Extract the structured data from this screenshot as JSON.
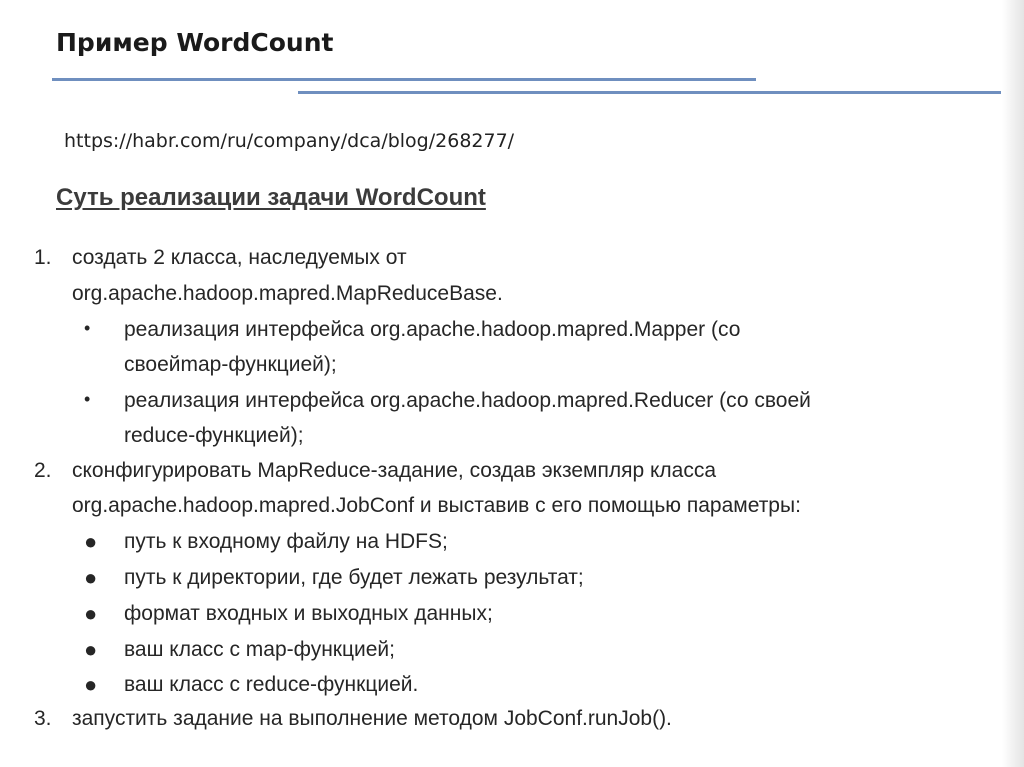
{
  "slide": {
    "title": "Пример WordCount",
    "url": "https://habr.com/ru/company/dca/blog/268277/",
    "subtitle": "Суть реализации задачи WordCount",
    "accent_color": "#6f8fbf",
    "list": [
      {
        "number": "1.",
        "lines": [
          "создать 2 класса, наследуемых от",
          "org.apache.hadoop.mapred.MapReduceBase."
        ],
        "bullet_icon": "bullet-icon",
        "subitems": [
          {
            "bullet": "•",
            "lines": [
              "реализация интерфейса org.apache.hadoop.mapred.Mapper (со",
              "своейmap-функцией);"
            ]
          },
          {
            "bullet": "•",
            "lines": [
              "реализация интерфейса org.apache.hadoop.mapred.Reducer (со своей",
              "reduce-функцией);"
            ]
          }
        ]
      },
      {
        "number": "2.",
        "lines": [
          "сконфигурировать MapReduce-задание, создав экземпляр класса",
          "org.apache.hadoop.mapred.JobConf и выставив с его помощью параметры:"
        ],
        "bullet_icon": "dot-icon",
        "subitems": [
          {
            "bullet": "●",
            "lines": [
              "путь к входному файлу на HDFS;"
            ]
          },
          {
            "bullet": "●",
            "lines": [
              "путь к директории, где будет лежать результат;"
            ]
          },
          {
            "bullet": "●",
            "lines": [
              "формат входных и выходных данных;"
            ]
          },
          {
            "bullet": "●",
            "lines": [
              "ваш класс с map-функцией;"
            ]
          },
          {
            "bullet": "●",
            "lines": [
              "ваш класс с reduce-функцией."
            ]
          }
        ]
      },
      {
        "number": "3.",
        "lines": [
          "запустить задание на выполнение методом JobConf.runJob()."
        ],
        "subitems": []
      }
    ]
  }
}
